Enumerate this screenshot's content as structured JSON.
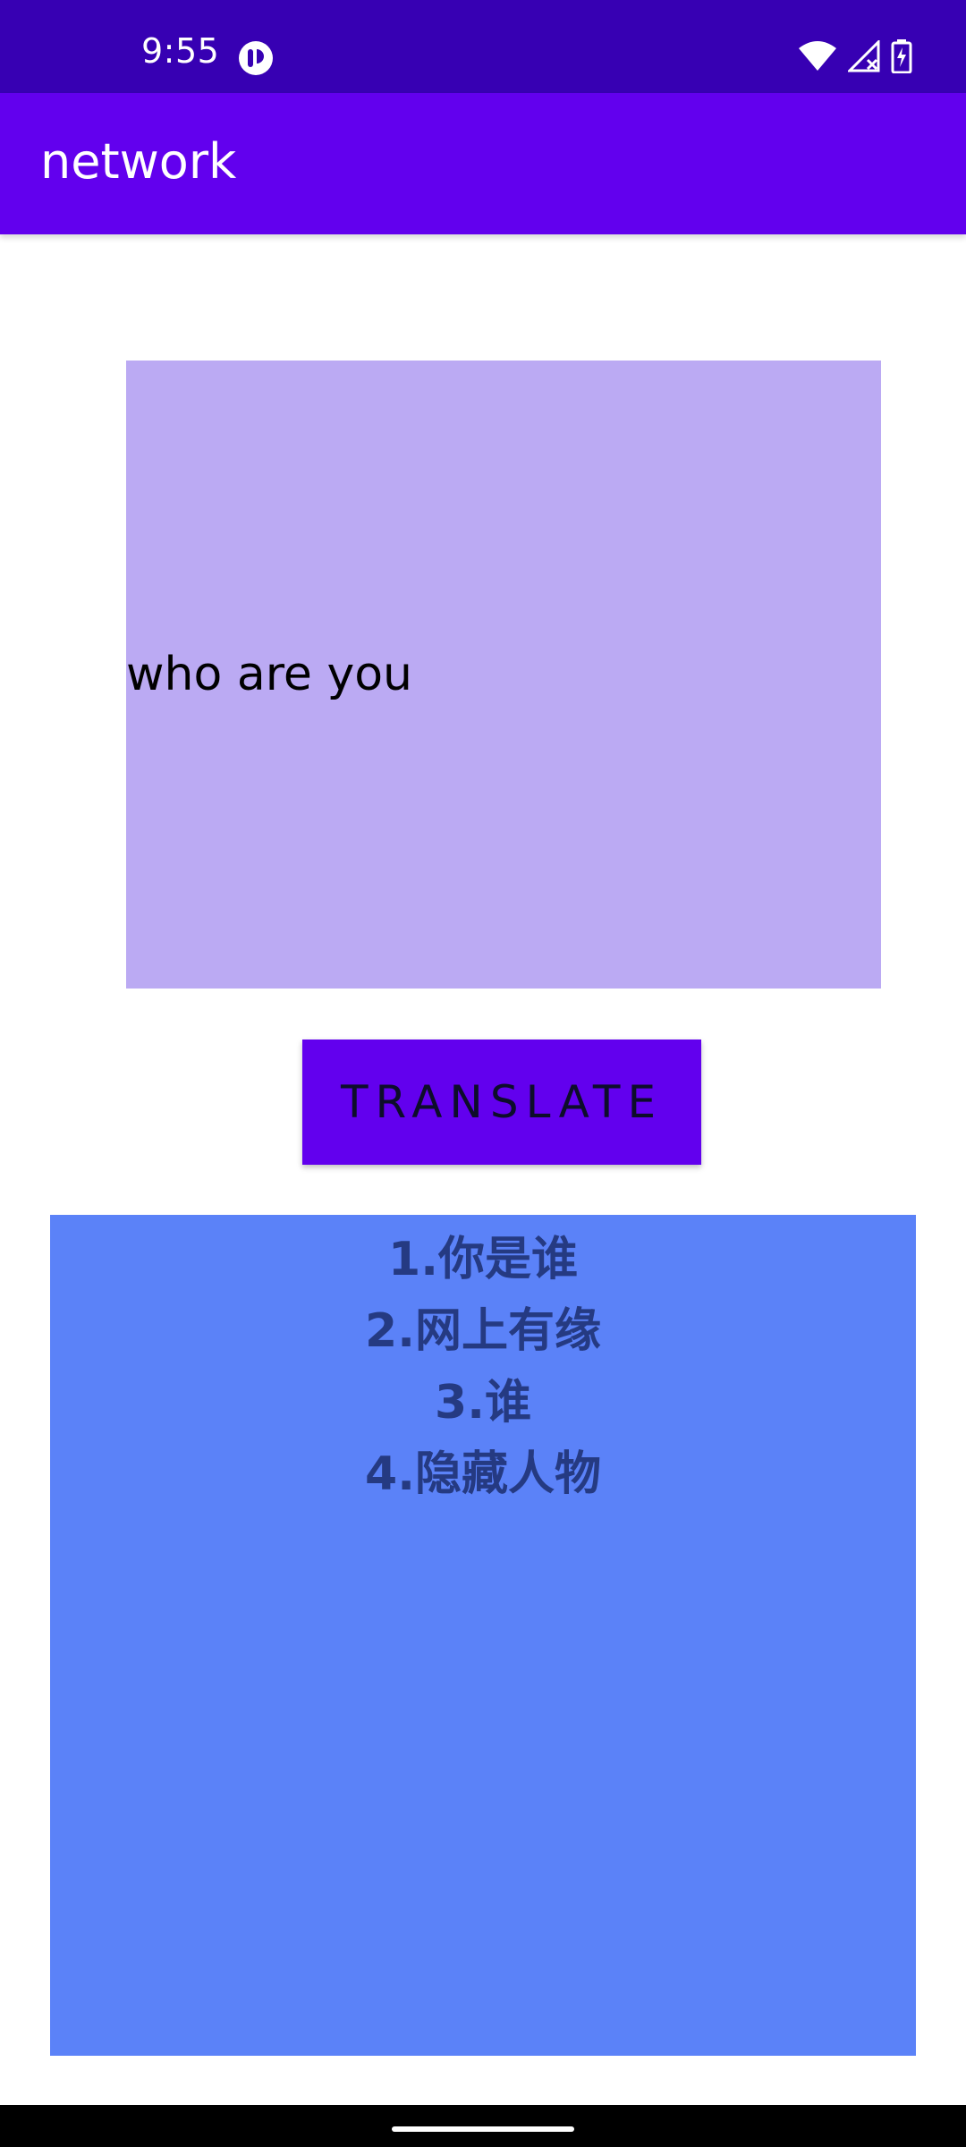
{
  "status_bar": {
    "time": "9:55",
    "icons": [
      "app-notification-icon",
      "wifi-icon",
      "cellular-no-signal-icon",
      "battery-charging-icon"
    ]
  },
  "app_bar": {
    "title": "network"
  },
  "input": {
    "text": "who are you"
  },
  "translate_button": {
    "label": "TRANSLATE"
  },
  "results": {
    "items": [
      "1.你是谁",
      "2.网上有缘",
      "3.谁",
      "4.隐藏人物"
    ]
  },
  "colors": {
    "status_bar": "#3700b3",
    "app_bar": "#6200ee",
    "input_box": "#bbaaf3",
    "button": "#6200ee",
    "result_box": "#5b82f8",
    "result_text": "#253a82"
  }
}
